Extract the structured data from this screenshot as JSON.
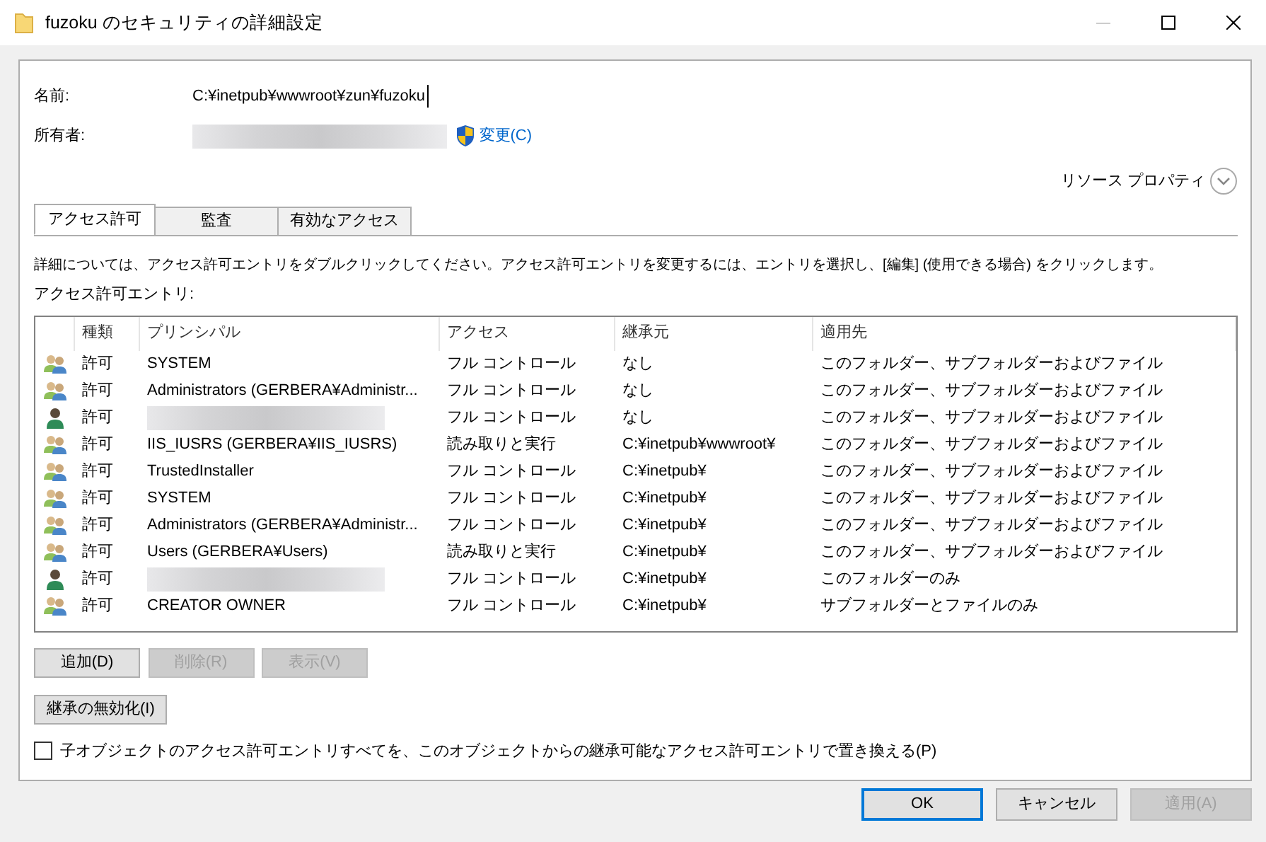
{
  "window": {
    "title": "fuzoku のセキュリティの詳細設定"
  },
  "name_field": {
    "label": "名前:",
    "value": "C:¥inetpub¥wwwroot¥zun¥fuzoku"
  },
  "owner_field": {
    "label": "所有者:",
    "redacted": true,
    "change_link": "変更(C)"
  },
  "resource_properties": {
    "label": "リソース プロパティ",
    "expanded": false
  },
  "tabs": [
    {
      "label": "アクセス許可",
      "selected": true
    },
    {
      "label": "監査",
      "selected": false
    },
    {
      "label": "有効なアクセス",
      "selected": false
    }
  ],
  "instructions": "詳細については、アクセス許可エントリをダブルクリックしてください。アクセス許可エントリを変更するには、エントリを選択し、[編集] (使用できる場合) をクリックします。",
  "entries_label": "アクセス許可エントリ:",
  "table": {
    "columns": [
      "種類",
      "プリンシパル",
      "アクセス",
      "継承元",
      "適用先"
    ],
    "rows": [
      {
        "kind": "group",
        "type": "許可",
        "principal": "SYSTEM",
        "access": "フル コントロール",
        "inherited_from": "なし",
        "applies_to": "このフォルダー、サブフォルダーおよびファイル"
      },
      {
        "kind": "group",
        "type": "許可",
        "principal": "Administrators (GERBERA¥Administr...",
        "access": "フル コントロール",
        "inherited_from": "なし",
        "applies_to": "このフォルダー、サブフォルダーおよびファイル"
      },
      {
        "kind": "user",
        "type": "許可",
        "redacted": true,
        "access": "フル コントロール",
        "inherited_from": "なし",
        "applies_to": "このフォルダー、サブフォルダーおよびファイル"
      },
      {
        "kind": "group",
        "type": "許可",
        "principal": "IIS_IUSRS (GERBERA¥IIS_IUSRS)",
        "access": "読み取りと実行",
        "inherited_from": "C:¥inetpub¥wwwroot¥",
        "applies_to": "このフォルダー、サブフォルダーおよびファイル"
      },
      {
        "kind": "group",
        "type": "許可",
        "principal": "TrustedInstaller",
        "access": "フル コントロール",
        "inherited_from": "C:¥inetpub¥",
        "applies_to": "このフォルダー、サブフォルダーおよびファイル"
      },
      {
        "kind": "group",
        "type": "許可",
        "principal": "SYSTEM",
        "access": "フル コントロール",
        "inherited_from": "C:¥inetpub¥",
        "applies_to": "このフォルダー、サブフォルダーおよびファイル"
      },
      {
        "kind": "group",
        "type": "許可",
        "principal": "Administrators (GERBERA¥Administr...",
        "access": "フル コントロール",
        "inherited_from": "C:¥inetpub¥",
        "applies_to": "このフォルダー、サブフォルダーおよびファイル"
      },
      {
        "kind": "group",
        "type": "許可",
        "principal": "Users (GERBERA¥Users)",
        "access": "読み取りと実行",
        "inherited_from": "C:¥inetpub¥",
        "applies_to": "このフォルダー、サブフォルダーおよびファイル"
      },
      {
        "kind": "user",
        "type": "許可",
        "redacted": true,
        "access": "フル コントロール",
        "inherited_from": "C:¥inetpub¥",
        "applies_to": "このフォルダーのみ"
      },
      {
        "kind": "group",
        "type": "許可",
        "principal": "CREATOR OWNER",
        "access": "フル コントロール",
        "inherited_from": "C:¥inetpub¥",
        "applies_to": "サブフォルダーとファイルのみ"
      }
    ]
  },
  "entry_buttons": [
    {
      "label": "追加(D)",
      "disabled": false
    },
    {
      "label": "削除(R)",
      "disabled": true
    },
    {
      "label": "表示(V)",
      "disabled": true
    }
  ],
  "disable_inheritance_button": {
    "label": "継承の無効化(I)",
    "disabled": false
  },
  "replace_checkbox": {
    "label": "子オブジェクトのアクセス許可エントリすべてを、このオブジェクトからの継承可能なアクセス許可エントリで置き換える(P)",
    "checked": false
  },
  "dialog_buttons": [
    {
      "label": "OK",
      "default": true,
      "disabled": false
    },
    {
      "label": "キャンセル",
      "default": false,
      "disabled": false
    },
    {
      "label": "適用(A)",
      "default": false,
      "disabled": true
    }
  ]
}
